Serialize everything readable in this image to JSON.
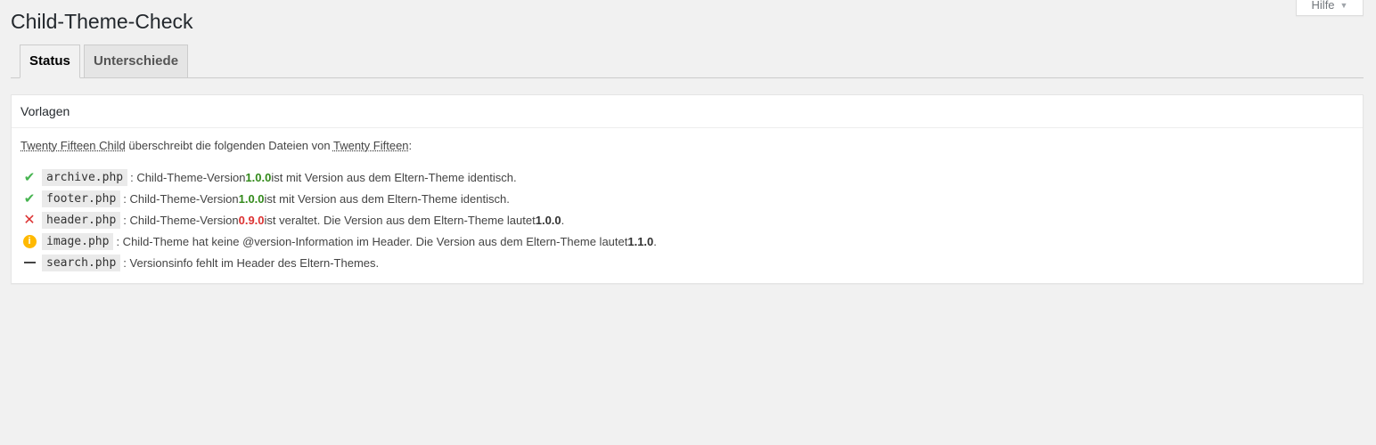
{
  "header": {
    "title": "Child-Theme-Check",
    "help_label": "Hilfe"
  },
  "tabs": [
    {
      "label": "Status",
      "active": true
    },
    {
      "label": "Unterschiede",
      "active": false
    }
  ],
  "box": {
    "title": "Vorlagen",
    "intro": {
      "child_theme": "Twenty Fifteen Child",
      "middle_text": " überschreibt die folgenden Dateien von ",
      "parent_theme": "Twenty Fifteen",
      "suffix": ":"
    },
    "files": [
      {
        "status_icon": "checkmark-icon",
        "file": "archive.php",
        "text_before": ": Child-Theme-Version ",
        "version": "1.0.0",
        "text_after": " ist mit Version aus dem Eltern-Theme identisch."
      },
      {
        "status_icon": "checkmark-icon",
        "file": "footer.php",
        "text_before": ": Child-Theme-Version ",
        "version": "1.0.0",
        "text_after": " ist mit Version aus dem Eltern-Theme identisch."
      },
      {
        "status_icon": "cross-icon",
        "file": "header.php",
        "text_before": ": Child-Theme-Version ",
        "version": "0.9.0",
        "text_after": " ist veraltet. Die Version aus dem Eltern-Theme lautet ",
        "parent_version": "1.0.0",
        "end": "."
      },
      {
        "status_icon": "info-icon",
        "file": "image.php",
        "text_before": ": Child-Theme hat keine @version-Information im Header. Die Version aus dem Eltern-Theme lautet ",
        "parent_version": "1.1.0",
        "end": "."
      },
      {
        "status_icon": "dash-icon",
        "file": "search.php",
        "text_before": ": Versionsinfo fehlt im Header des Eltern-Themes."
      }
    ]
  },
  "colors": {
    "ok": "#46b450",
    "version_ok": "#338a1b",
    "error": "#dc3232",
    "warning": "#ffb900"
  }
}
